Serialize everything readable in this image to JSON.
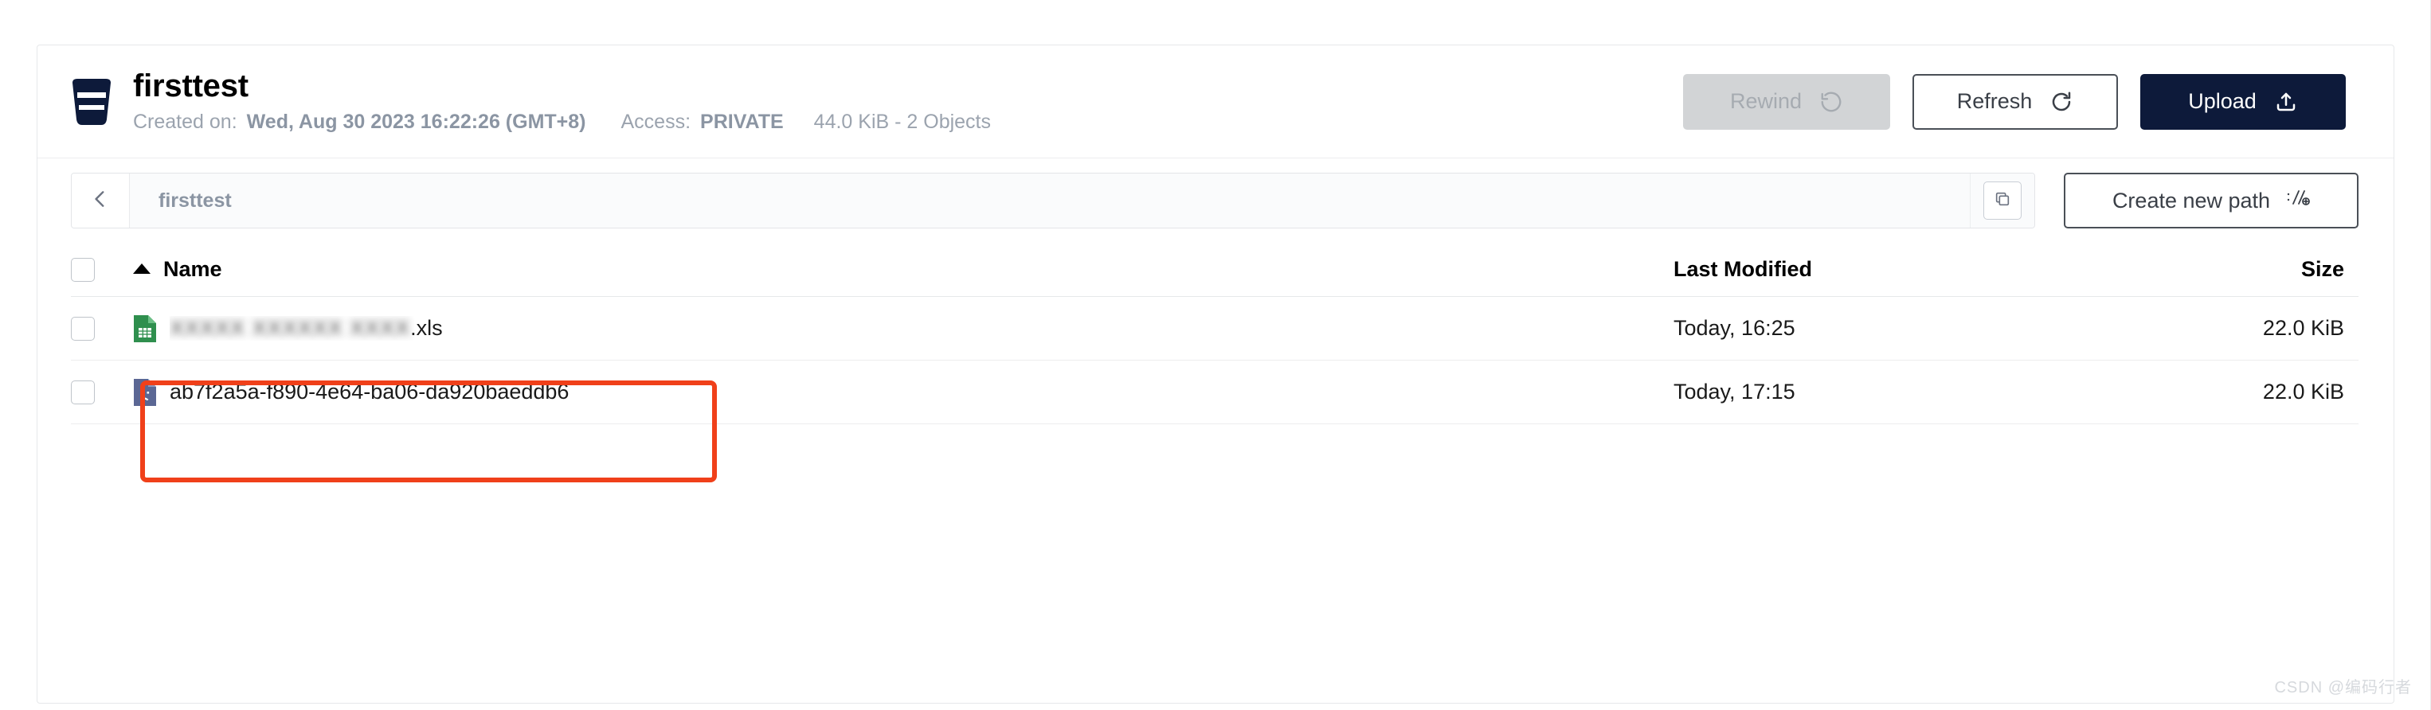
{
  "bucket": {
    "icon": "bucket-icon",
    "name": "firsttest",
    "created_label": "Created on:",
    "created_value": "Wed, Aug 30 2023 16:22:26 (GMT+8)",
    "access_label": "Access:",
    "access_value": "PRIVATE",
    "size_summary": "44.0 KiB - 2 Objects"
  },
  "header_actions": {
    "rewind": {
      "label": "Rewind",
      "icon": "rewind-icon",
      "disabled": true
    },
    "refresh": {
      "label": "Refresh",
      "icon": "refresh-icon"
    },
    "upload": {
      "label": "Upload",
      "icon": "upload-icon"
    }
  },
  "path_bar": {
    "back_icon": "chevron-left-icon",
    "crumb": "firsttest",
    "copy_icon": "copy-icon",
    "create_path": {
      "label": "Create new path",
      "icon": "new-path-icon"
    }
  },
  "table": {
    "select_all": "",
    "columns": {
      "name": "Name",
      "last_modified": "Last Modified",
      "size": "Size"
    },
    "sort": {
      "column": "Name",
      "direction": "asc",
      "icon": "sort-asc-caret-icon"
    },
    "rows": [
      {
        "icon": "spreadsheet-file-icon",
        "name_redacted_prefix": "XXXXX XXXXXX XXXX",
        "name_visible_suffix": ".xls",
        "last_modified": "Today, 16:25",
        "size": "22.0 KiB"
      },
      {
        "icon": "unknown-file-icon",
        "name": "ab7f2a5a-f890-4e64-ba06-da920baeddb6",
        "last_modified": "Today, 17:15",
        "size": "22.0 KiB"
      }
    ]
  },
  "annotation": {
    "color": "#f0401a",
    "target": "ab7f2a5a-f890-4e64-ba06-da920baeddb6"
  },
  "watermark": "CSDN @编码行者",
  "colors": {
    "brand_navy": "#0d1a3a",
    "accent_red": "#f0401a",
    "muted_text": "#9ba3ae",
    "border": "#e6e8ea"
  }
}
